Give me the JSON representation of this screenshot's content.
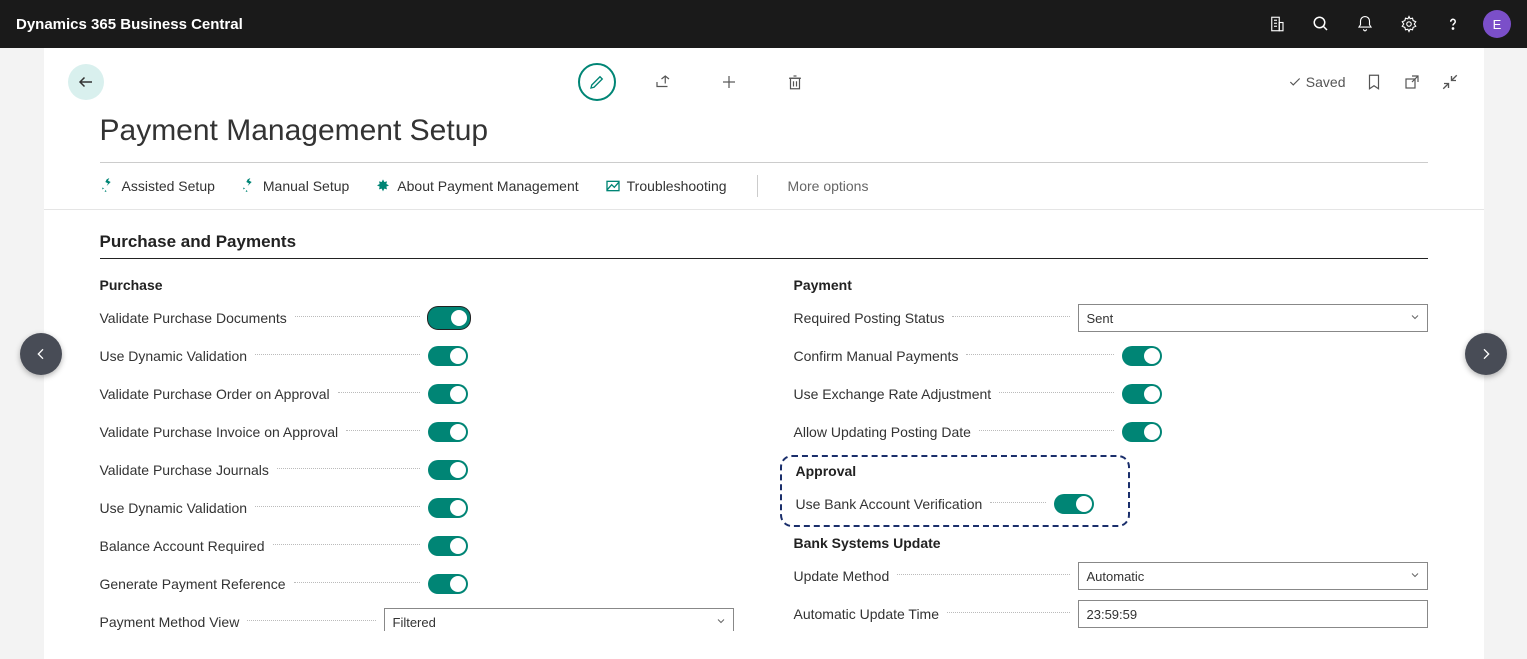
{
  "app_title": "Dynamics 365 Business Central",
  "avatar_initial": "E",
  "saved_label": "Saved",
  "page_title": "Payment Management Setup",
  "actions": {
    "assisted_setup": "Assisted Setup",
    "manual_setup": "Manual Setup",
    "about": "About Payment Management",
    "troubleshooting": "Troubleshooting",
    "more_options": "More options"
  },
  "section_title": "Purchase and Payments",
  "purchase": {
    "group": "Purchase",
    "validate_docs": "Validate Purchase Documents",
    "use_dynamic_validation_1": "Use Dynamic Validation",
    "validate_po_approval": "Validate Purchase Order on Approval",
    "validate_pi_approval": "Validate Purchase Invoice on Approval",
    "validate_journals": "Validate Purchase Journals",
    "use_dynamic_validation_2": "Use Dynamic Validation",
    "balance_required": "Balance Account Required",
    "gen_payment_ref": "Generate Payment Reference",
    "payment_method_view": "Payment Method View",
    "payment_method_view_value": "Filtered"
  },
  "payment": {
    "group": "Payment",
    "required_posting_status": "Required Posting Status",
    "required_posting_status_value": "Sent",
    "confirm_manual": "Confirm Manual Payments",
    "exchange_rate_adj": "Use Exchange Rate Adjustment",
    "allow_update_posting_date": "Allow Updating Posting Date"
  },
  "approval": {
    "group": "Approval",
    "use_bank_verification": "Use Bank Account Verification"
  },
  "bank_update": {
    "group": "Bank Systems Update",
    "update_method": "Update Method",
    "update_method_value": "Automatic",
    "auto_update_time": "Automatic Update Time",
    "auto_update_time_value": "23:59:59"
  }
}
